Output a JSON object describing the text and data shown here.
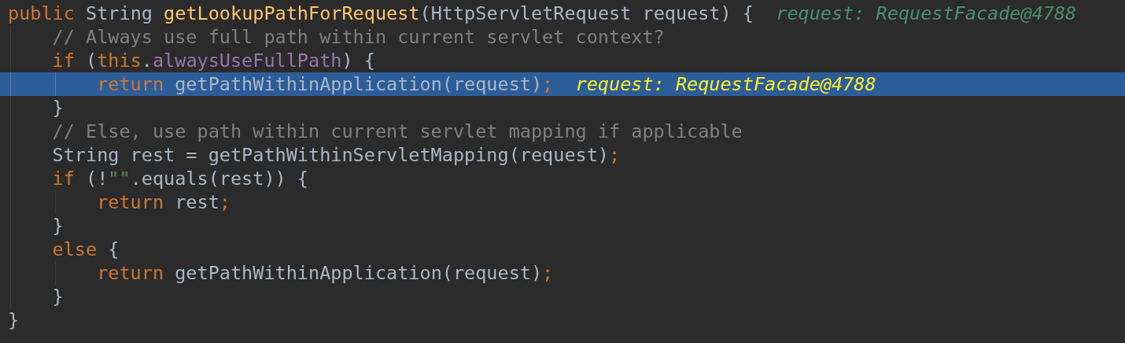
{
  "editor": {
    "lines": [
      {
        "selected": false,
        "tokens": [
          {
            "kind": "keyword",
            "text": "public "
          },
          {
            "kind": "plain",
            "text": "String "
          },
          {
            "kind": "method",
            "text": "getLookupPathForRequest"
          },
          {
            "kind": "plain",
            "text": "(HttpServletRequest request) {"
          }
        ],
        "debug_value": "request: RequestFacade@4788",
        "children": [
          {
            "selected": false,
            "tokens": [
              {
                "kind": "comment",
                "text": "// Always use full path within current servlet context?"
              }
            ]
          },
          {
            "selected": false,
            "tokens": [
              {
                "kind": "keyword",
                "text": "if "
              },
              {
                "kind": "plain",
                "text": "("
              },
              {
                "kind": "keyword",
                "text": "this"
              },
              {
                "kind": "plain",
                "text": "."
              },
              {
                "kind": "field",
                "text": "alwaysUseFullPath"
              },
              {
                "kind": "plain",
                "text": ") {"
              }
            ],
            "children": [
              {
                "selected": true,
                "tokens": [
                  {
                    "kind": "keyword",
                    "text": "return "
                  },
                  {
                    "kind": "plain",
                    "text": "getPathWithinApplication(request)"
                  },
                  {
                    "kind": "keyword",
                    "text": ";"
                  }
                ],
                "debug_value": "request: RequestFacade@4788"
              }
            ]
          },
          {
            "selected": false,
            "tokens": [
              {
                "kind": "plain",
                "text": "}"
              }
            ]
          },
          {
            "selected": false,
            "tokens": [
              {
                "kind": "comment",
                "text": "// Else, use path within current servlet mapping if applicable"
              }
            ]
          },
          {
            "selected": false,
            "tokens": [
              {
                "kind": "plain",
                "text": "String rest = getPathWithinServletMapping(request)"
              },
              {
                "kind": "keyword",
                "text": ";"
              }
            ]
          },
          {
            "selected": false,
            "tokens": [
              {
                "kind": "keyword",
                "text": "if "
              },
              {
                "kind": "plain",
                "text": "(!"
              },
              {
                "kind": "string",
                "text": "\"\""
              },
              {
                "kind": "plain",
                "text": ".equals(rest)) {"
              }
            ],
            "children": [
              {
                "selected": false,
                "tokens": [
                  {
                    "kind": "keyword",
                    "text": "return "
                  },
                  {
                    "kind": "plain",
                    "text": "rest"
                  },
                  {
                    "kind": "keyword",
                    "text": ";"
                  }
                ]
              }
            ]
          },
          {
            "selected": false,
            "tokens": [
              {
                "kind": "plain",
                "text": "}"
              }
            ]
          },
          {
            "selected": false,
            "tokens": [
              {
                "kind": "keyword",
                "text": "else "
              },
              {
                "kind": "plain",
                "text": "{"
              }
            ],
            "children": [
              {
                "selected": false,
                "tokens": [
                  {
                    "kind": "keyword",
                    "text": "return "
                  },
                  {
                    "kind": "plain",
                    "text": "getPathWithinApplication(request)"
                  },
                  {
                    "kind": "keyword",
                    "text": ";"
                  }
                ]
              }
            ]
          },
          {
            "selected": false,
            "tokens": [
              {
                "kind": "plain",
                "text": "}"
              }
            ]
          }
        ]
      },
      {
        "selected": false,
        "tokens": [
          {
            "kind": "plain",
            "text": "}"
          }
        ]
      }
    ]
  }
}
